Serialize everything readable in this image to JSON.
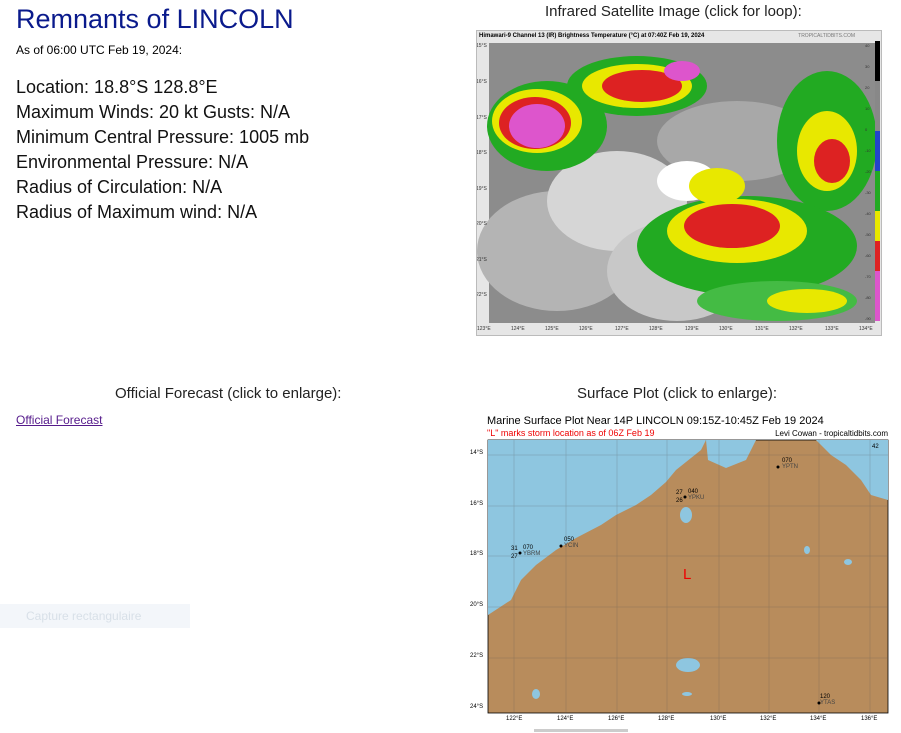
{
  "storm": {
    "title": "Remnants of LINCOLN",
    "as_of": "As of 06:00 UTC Feb 19, 2024:",
    "location": "Location: 18.8°S 128.8°E",
    "winds": "Maximum Winds: 20 kt  Gusts: N/A",
    "min_pressure": "Minimum Central Pressure: 1005 mb",
    "env_pressure": "Environmental Pressure: N/A",
    "radius_circ": "Radius of Circulation: N/A",
    "radius_max_wind": "Radius of Maximum wind: N/A"
  },
  "satellite": {
    "heading": "Infrared Satellite Image (click for loop):",
    "image_title": "Himawari-9 Channel 13 (IR) Brightness Temperature (°C) at 07:40Z Feb 19, 2024",
    "credit": "TROPICALTIDBITS.COM",
    "lat_labels": [
      "15°S",
      "16°S",
      "17°S",
      "18°S",
      "19°S",
      "20°S",
      "21°S",
      "22°S"
    ],
    "lon_labels": [
      "123°E",
      "124°E",
      "125°E",
      "126°E",
      "127°E",
      "128°E",
      "129°E",
      "130°E",
      "131°E",
      "132°E",
      "133°E",
      "134°E"
    ],
    "scale_labels": [
      "40",
      "30",
      "20",
      "10",
      "0",
      "-10",
      "-20",
      "-30",
      "-40",
      "-50",
      "-60",
      "-70",
      "-80",
      "-90"
    ]
  },
  "forecast": {
    "heading": "Official Forecast (click to enlarge):",
    "link_text": "Official Forecast"
  },
  "overlay": {
    "capture_text": "Capture rectangulaire"
  },
  "surface": {
    "heading": "Surface Plot (click to enlarge):",
    "title": "Marine Surface Plot Near 14P LINCOLN 09:15Z-10:45Z Feb 19 2024",
    "subtitle": "\"L\" marks storm location as of 06Z Feb 19",
    "credit": "Levi Cowan - tropicaltidbits.com",
    "lat_labels": [
      "14°S",
      "16°S",
      "18°S",
      "20°S",
      "22°S",
      "24°S"
    ],
    "lon_labels": [
      "122°E",
      "124°E",
      "126°E",
      "128°E",
      "130°E",
      "132°E",
      "134°E",
      "136°E"
    ],
    "storm_marker": "L",
    "stations": [
      {
        "top": "070",
        "side": "",
        "bottom": "YPTN"
      },
      {
        "top": "040",
        "side": "27",
        "bottom": "YPKU"
      },
      {
        "top": "050",
        "side": "",
        "bottom": "YCIN"
      },
      {
        "top": "070",
        "side": "31",
        "bottom": "YBRM"
      },
      {
        "top": "120",
        "side": "",
        "bottom": "YTAS"
      }
    ],
    "station_side_bottom": "26",
    "station_side_bottom2": "27",
    "corner_label": "42"
  }
}
